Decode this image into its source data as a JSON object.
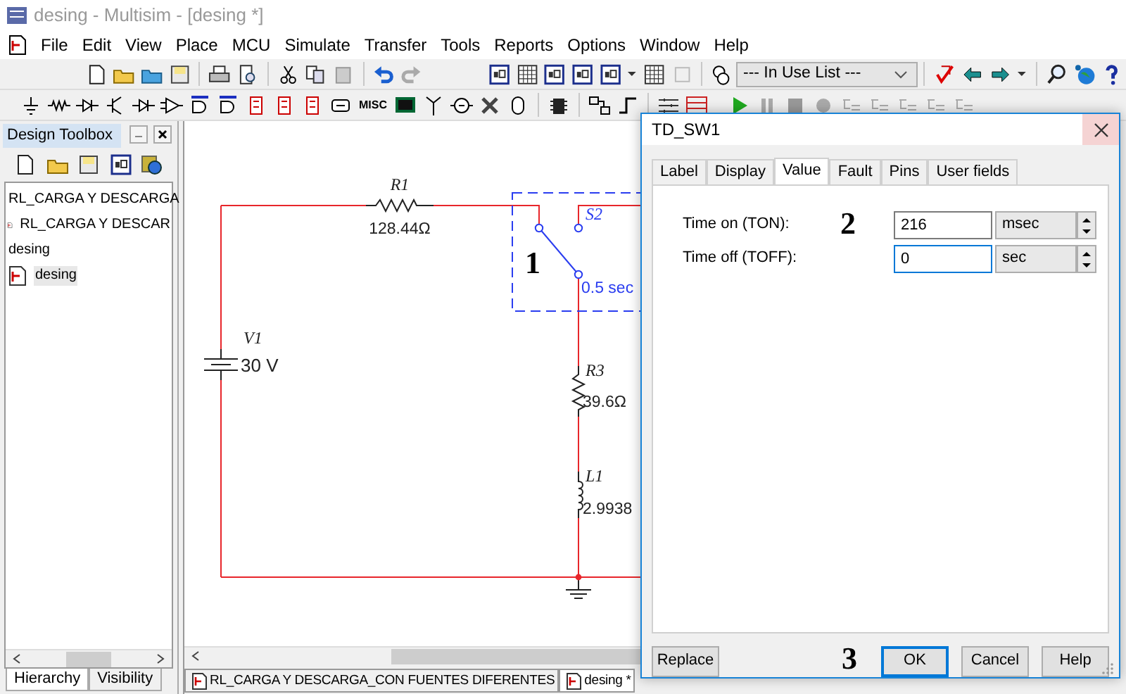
{
  "window": {
    "title": "desing - Multisim - [desing *]"
  },
  "menu": [
    "File",
    "Edit",
    "View",
    "Place",
    "MCU",
    "Simulate",
    "Transfer",
    "Tools",
    "Reports",
    "Options",
    "Window",
    "Help"
  ],
  "toolbar": {
    "component_list": "--- In Use List ---",
    "misc_label": "MISC"
  },
  "design_toolbox": {
    "title": "Design Toolbox",
    "tree": [
      {
        "label": "RL_CARGA Y DESCARGA",
        "selected": false,
        "children": [
          {
            "label": "RL_CARGA Y DESCAR",
            "selected": false
          }
        ]
      },
      {
        "label": "desing",
        "selected": false,
        "children": [
          {
            "label": "desing",
            "selected": true
          }
        ]
      }
    ],
    "tabs": [
      {
        "label": "Hierarchy",
        "selected": true
      },
      {
        "label": "Visibility",
        "selected": false
      }
    ]
  },
  "schematic": {
    "components": [
      {
        "kind": "resistor",
        "ref": "R1",
        "value": "128.44Ω"
      },
      {
        "kind": "switch",
        "ref": "S2",
        "value": "0.5 sec"
      },
      {
        "kind": "battery",
        "ref": "V1",
        "value": "30 V"
      },
      {
        "kind": "resistor",
        "ref": "R3",
        "value": "39.6Ω"
      },
      {
        "kind": "inductor",
        "ref": "L1",
        "value": "2.9938"
      }
    ]
  },
  "document_tabs": [
    {
      "label": "RL_CARGA Y DESCARGA_CON FUENTES DIFERENTES",
      "selected": false
    },
    {
      "label": "desing *",
      "selected": true
    }
  ],
  "dialog": {
    "title": "TD_SW1",
    "tabs": [
      {
        "label": "Label",
        "selected": false
      },
      {
        "label": "Display",
        "selected": false
      },
      {
        "label": "Value",
        "selected": true
      },
      {
        "label": "Fault",
        "selected": false
      },
      {
        "label": "Pins",
        "selected": false
      },
      {
        "label": "User fields",
        "selected": false
      }
    ],
    "fields": [
      {
        "label": "Time on (TON):",
        "value": "216",
        "unit": "msec",
        "focused": false
      },
      {
        "label": "Time off (TOFF):",
        "value": "0",
        "unit": "sec",
        "focused": true
      }
    ],
    "buttons": [
      {
        "label": "Replace",
        "default": false
      },
      {
        "label": "OK",
        "default": true
      },
      {
        "label": "Cancel",
        "default": false
      },
      {
        "label": "Help",
        "default": false
      }
    ]
  },
  "annotations": [
    "1",
    "2",
    "3"
  ]
}
